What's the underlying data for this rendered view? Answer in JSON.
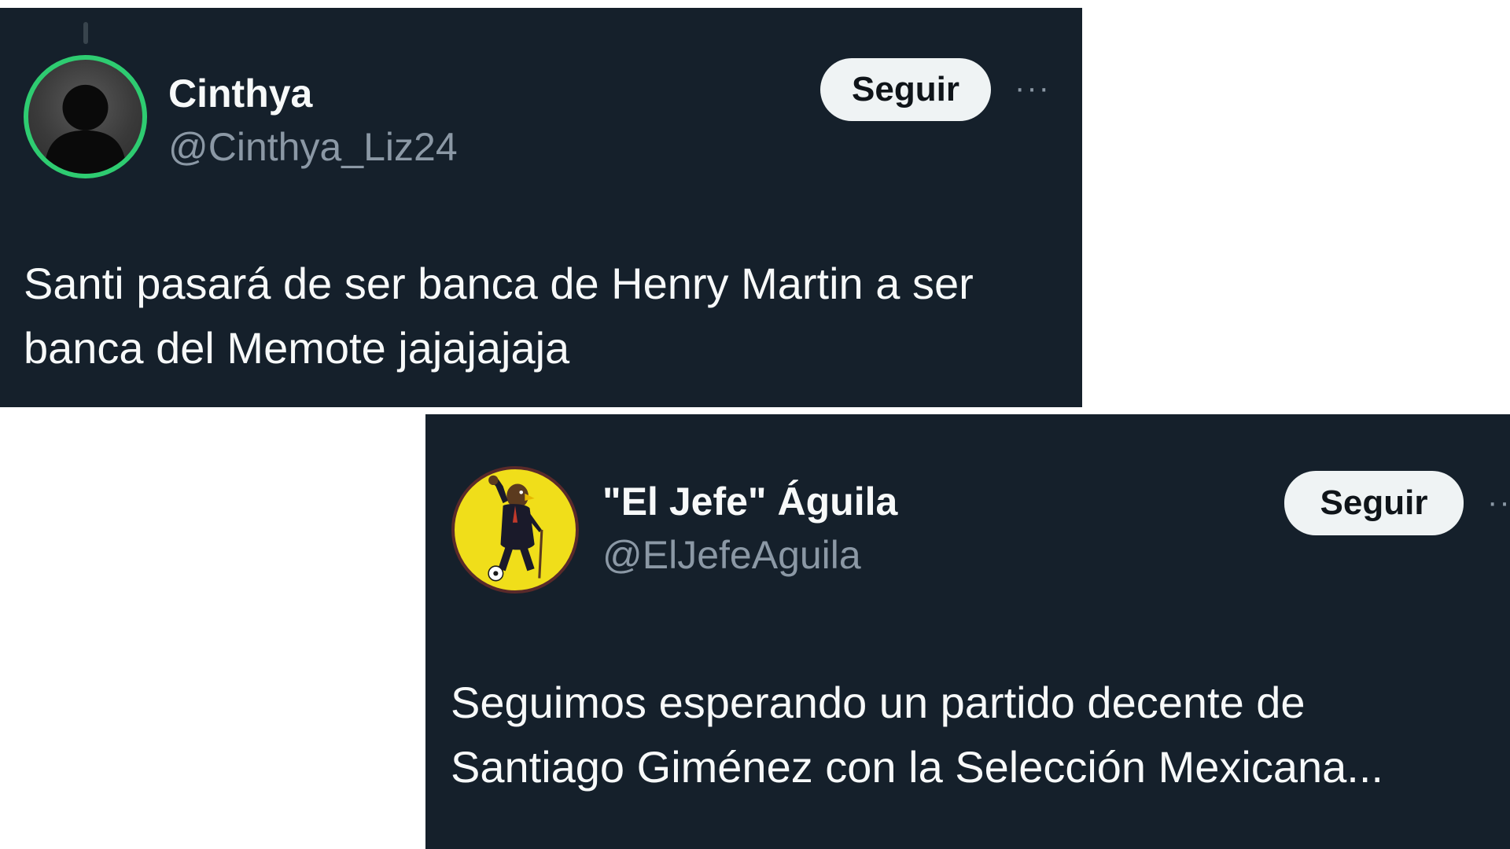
{
  "tweets": [
    {
      "name": "Cinthya",
      "handle": "@Cinthya_Liz24",
      "follow_label": "Seguir",
      "more_label": "···",
      "avatar_icon": "default-profile-silhouette-icon",
      "avatar_ring_color": "#2ecc71",
      "text": "Santi pasará de ser banca de Henry Martin a ser\nbanca del Memote jajajajaja"
    },
    {
      "name": "\"El Jefe\" Águila",
      "handle": "@ElJefeAguila",
      "follow_label": "Seguir",
      "more_label": "··",
      "avatar_icon": "eagle-mascot-icon",
      "avatar_bg_color": "#f0de1a",
      "text": "Seguimos esperando un partido decente de\nSantiago Giménez con la Selección Mexicana..."
    }
  ],
  "colors": {
    "card_background": "#15202b",
    "text_primary": "#f7f9f9",
    "text_secondary": "#8b98a5",
    "button_background": "#eff3f4"
  }
}
